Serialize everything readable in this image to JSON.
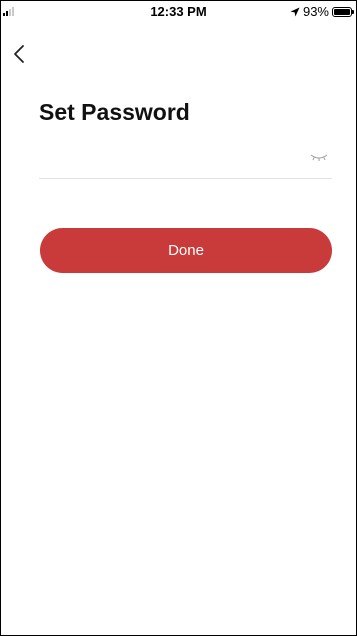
{
  "status_bar": {
    "time": "12:33 PM",
    "battery_percent": "93%",
    "location_icon": "location-arrow-icon",
    "signal_icon": "cellular-signal-icon",
    "battery_icon": "battery-icon"
  },
  "nav": {
    "back_icon": "chevron-left-icon"
  },
  "page": {
    "title": "Set Password"
  },
  "password_field": {
    "value": "",
    "placeholder": "",
    "visibility_icon": "eye-closed-icon"
  },
  "actions": {
    "done_label": "Done"
  },
  "colors": {
    "accent": "#c93a3a",
    "divider": "#e2e2e2"
  }
}
